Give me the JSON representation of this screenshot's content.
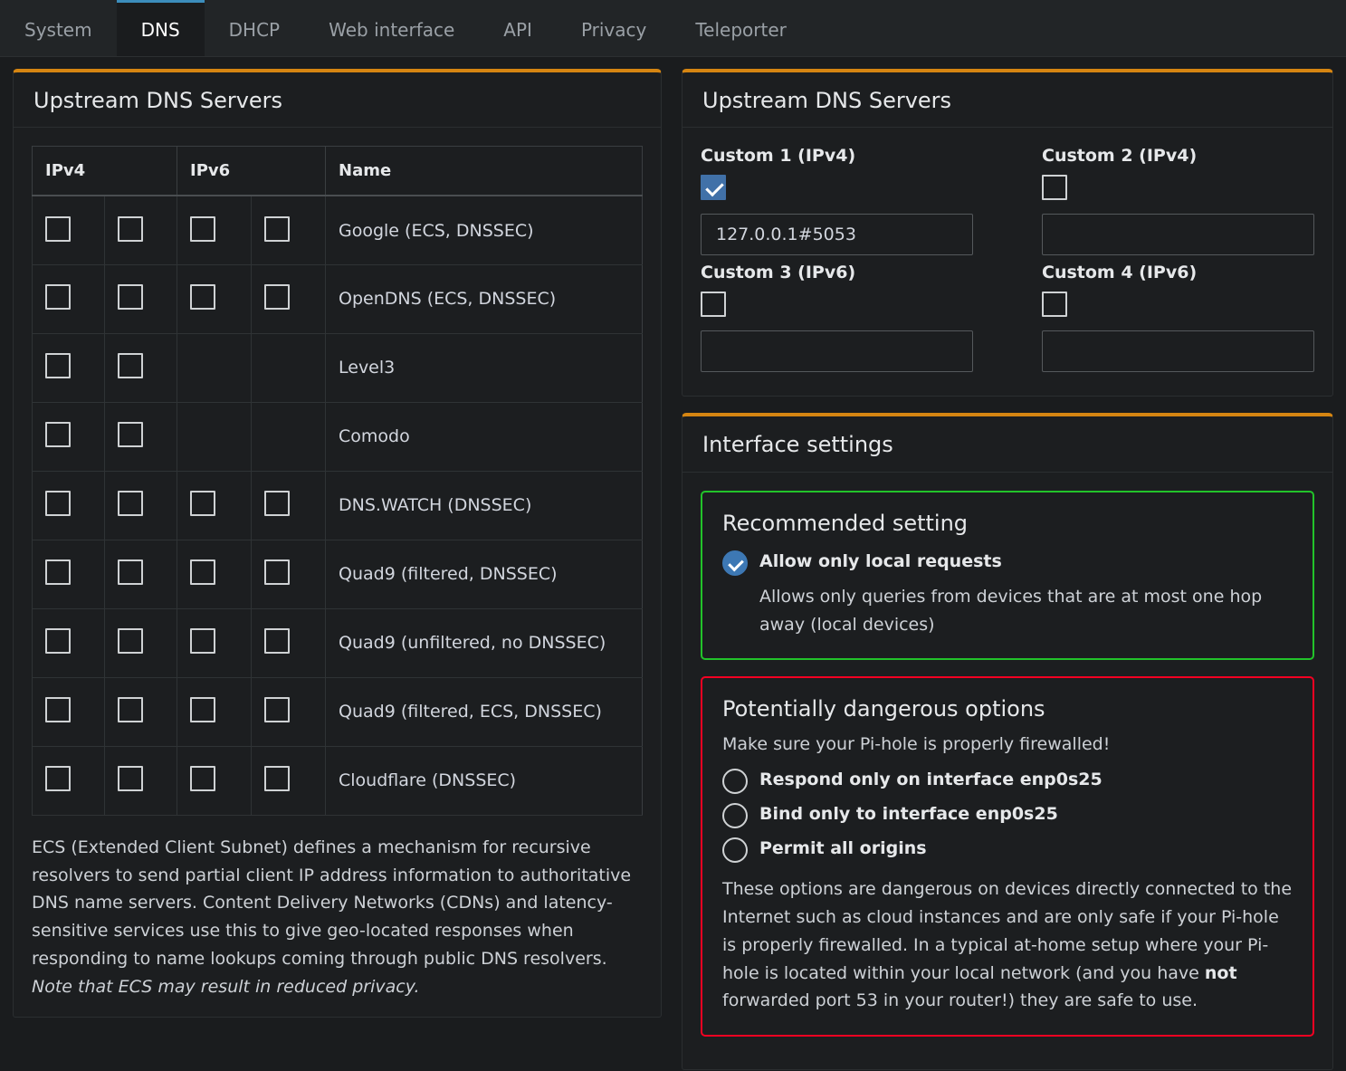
{
  "tabs": [
    {
      "label": "System",
      "active": false
    },
    {
      "label": "DNS",
      "active": true
    },
    {
      "label": "DHCP",
      "active": false
    },
    {
      "label": "Web interface",
      "active": false
    },
    {
      "label": "API",
      "active": false
    },
    {
      "label": "Privacy",
      "active": false
    },
    {
      "label": "Teleporter",
      "active": false
    }
  ],
  "colors": {
    "panel_accent": "#d58512",
    "tab_accent": "#3c8dbc",
    "checkbox_checked": "#4171a8",
    "good_border": "#22c32a",
    "danger_border": "#f40022",
    "page_bg": "#1a1c1e",
    "panel_bg": "#1c1e20"
  },
  "left_panel": {
    "title": "Upstream DNS Servers",
    "table": {
      "headers": [
        "IPv4",
        "IPv6",
        "Name"
      ],
      "rows": [
        {
          "name": "Google (ECS, DNSSEC)",
          "ipv4": [
            false,
            false
          ],
          "ipv6": [
            false,
            false
          ],
          "has_ipv6": true
        },
        {
          "name": "OpenDNS (ECS, DNSSEC)",
          "ipv4": [
            false,
            false
          ],
          "ipv6": [
            false,
            false
          ],
          "has_ipv6": true
        },
        {
          "name": "Level3",
          "ipv4": [
            false,
            false
          ],
          "ipv6": [],
          "has_ipv6": false
        },
        {
          "name": "Comodo",
          "ipv4": [
            false,
            false
          ],
          "ipv6": [],
          "has_ipv6": false
        },
        {
          "name": "DNS.WATCH (DNSSEC)",
          "ipv4": [
            false,
            false
          ],
          "ipv6": [
            false,
            false
          ],
          "has_ipv6": true
        },
        {
          "name": "Quad9 (filtered, DNSSEC)",
          "ipv4": [
            false,
            false
          ],
          "ipv6": [
            false,
            false
          ],
          "has_ipv6": true
        },
        {
          "name": "Quad9 (unfiltered, no DNSSEC)",
          "ipv4": [
            false,
            false
          ],
          "ipv6": [
            false,
            false
          ],
          "has_ipv6": true
        },
        {
          "name": "Quad9 (filtered, ECS, DNSSEC)",
          "ipv4": [
            false,
            false
          ],
          "ipv6": [
            false,
            false
          ],
          "has_ipv6": true
        },
        {
          "name": "Cloudflare (DNSSEC)",
          "ipv4": [
            false,
            false
          ],
          "ipv6": [
            false,
            false
          ],
          "has_ipv6": true
        }
      ]
    },
    "ecs_note_plain": "ECS (Extended Client Subnet) defines a mechanism for recursive resolvers to send partial client IP address information to authoritative DNS name servers. Content Delivery Networks (CDNs) and latency-sensitive services use this to give geo-located responses when responding to name lookups coming through public DNS resolvers. ",
    "ecs_note_italic": "Note that ECS may result in reduced privacy."
  },
  "right_panel": {
    "title": "Upstream DNS Servers",
    "custom_fields": [
      {
        "label": "Custom 1 (IPv4)",
        "checked": true,
        "value": "127.0.0.1#5053",
        "placeholder": ""
      },
      {
        "label": "Custom 2 (IPv4)",
        "checked": false,
        "value": "",
        "placeholder": ""
      },
      {
        "label": "Custom 3 (IPv6)",
        "checked": false,
        "value": "",
        "placeholder": ""
      },
      {
        "label": "Custom 4 (IPv6)",
        "checked": false,
        "value": "",
        "placeholder": ""
      }
    ]
  },
  "interface_panel": {
    "title": "Interface settings",
    "recommended": {
      "title": "Recommended setting",
      "option_label": "Allow only local requests",
      "option_selected": true,
      "option_desc": "Allows only queries from devices that are at most one hop away (local devices)"
    },
    "dangerous": {
      "title": "Potentially dangerous options",
      "subtitle": "Make sure your Pi-hole is properly firewalled!",
      "options": [
        {
          "label": "Respond only on interface enp0s25",
          "selected": false
        },
        {
          "label": "Bind only to interface enp0s25",
          "selected": false
        },
        {
          "label": "Permit all origins",
          "selected": false
        }
      ],
      "note_part1": "These options are dangerous on devices directly connected to the Internet such as cloud instances and are only safe if your Pi-hole is properly firewalled. In a typical at-home setup where your Pi-hole is located within your local network (and you have ",
      "note_bold": "not",
      "note_part2": " forwarded port 53 in your router!) they are safe to use."
    }
  }
}
